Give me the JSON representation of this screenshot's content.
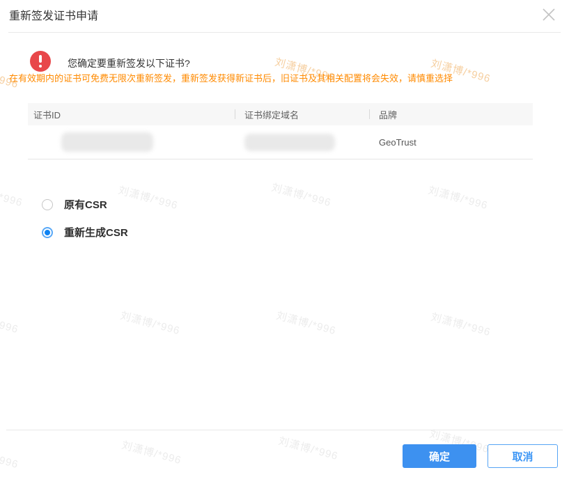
{
  "dialog": {
    "title": "重新签发证书申请"
  },
  "alert": {
    "question": "您确定要重新签发以下证书?",
    "warning": "在有效期内的证书可免费无限次重新签发，重新签发获得新证书后，旧证书及其相关配置将会失效，请慎重选择"
  },
  "table": {
    "headers": [
      "证书ID",
      "证书绑定域名",
      "品牌"
    ],
    "rows": [
      {
        "cert_id_redacted": true,
        "domain_redacted": true,
        "brand": "GeoTrust"
      }
    ]
  },
  "options": {
    "items": [
      {
        "label": "原有CSR",
        "selected": false
      },
      {
        "label": "重新生成CSR",
        "selected": true
      }
    ]
  },
  "footer": {
    "confirm_label": "确定",
    "cancel_label": "取消"
  },
  "watermark": {
    "text": "刘潇博/*996"
  },
  "colors": {
    "primary_blue": "#3d91f0",
    "warning_orange": "#ff8a00",
    "alert_red": "#e8474a",
    "watermark_gray": "#ececec",
    "watermark_orange_tint": "#f6cfa0",
    "header_bg": "#f7f7f7"
  }
}
